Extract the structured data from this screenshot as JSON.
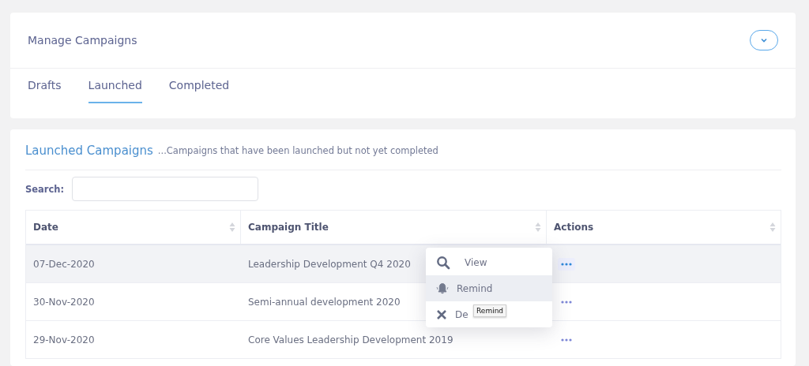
{
  "header": {
    "title": "Manage Campaigns"
  },
  "tabs": [
    {
      "label": "Drafts",
      "selected": false
    },
    {
      "label": "Launched",
      "selected": true
    },
    {
      "label": "Completed",
      "selected": false
    }
  ],
  "section": {
    "title": "Launched Campaigns",
    "subtitle": "...Campaigns that have been launched but not yet completed"
  },
  "search": {
    "label": "Search:"
  },
  "table": {
    "columns": [
      "Date",
      "Campaign Title",
      "Actions"
    ],
    "rows": [
      {
        "date": "07-Dec-2020",
        "title": "Leadership Development Q4 2020",
        "selected": true
      },
      {
        "date": "30-Nov-2020",
        "title": "Semi-annual development 2020",
        "selected": false
      },
      {
        "date": "29-Nov-2020",
        "title": "Core Values Leadership Development 2019",
        "selected": false
      }
    ]
  },
  "action_menu": {
    "items": [
      {
        "kind": "view",
        "label": "View",
        "hovered": false
      },
      {
        "kind": "remind",
        "label": "Remind",
        "hovered": true
      },
      {
        "kind": "delete",
        "label": "De",
        "hovered": false
      }
    ]
  },
  "tooltip": "Remind"
}
